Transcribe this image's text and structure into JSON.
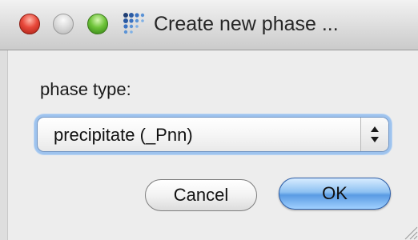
{
  "window": {
    "title": "Create new phase ...",
    "traffic_lights": {
      "close": "#e8493b",
      "minimize": "#d9d9d9",
      "zoom": "#6fc43a"
    },
    "app_icon": "dot-grid-icon"
  },
  "form": {
    "phase_type_label": "phase type:",
    "phase_type_value": "precipitate (_Pnn)"
  },
  "buttons": {
    "cancel_label": "Cancel",
    "ok_label": "OK"
  },
  "colors": {
    "focus_ring": "#9ec3ee",
    "default_button": "#5a9be3"
  }
}
